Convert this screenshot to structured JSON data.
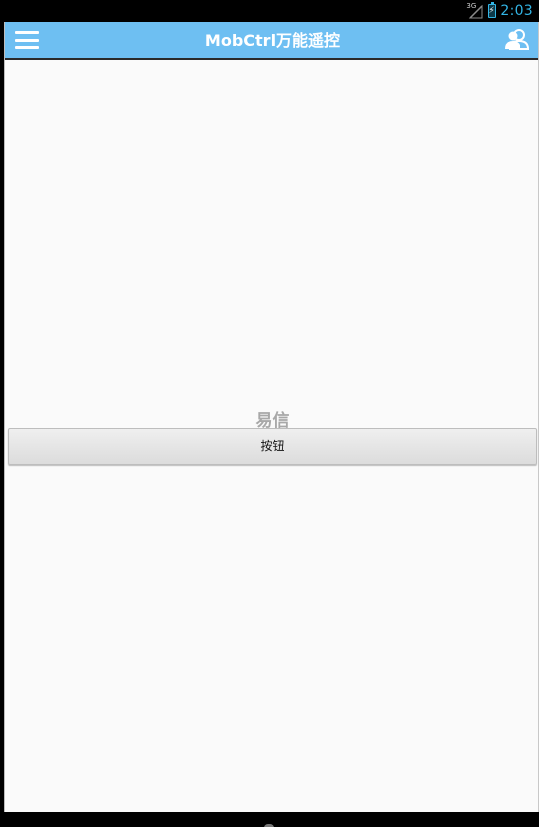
{
  "status_bar": {
    "network_type": "3G",
    "time": "2:03",
    "accent_color": "#33b5e5"
  },
  "action_bar": {
    "title": "MobCtrl万能遥控",
    "background_color": "#6ebff2",
    "menu_icon": "hamburger-menu-icon",
    "right_icon": "users-icon"
  },
  "content": {
    "label": "易信",
    "button_label": "按钮"
  }
}
